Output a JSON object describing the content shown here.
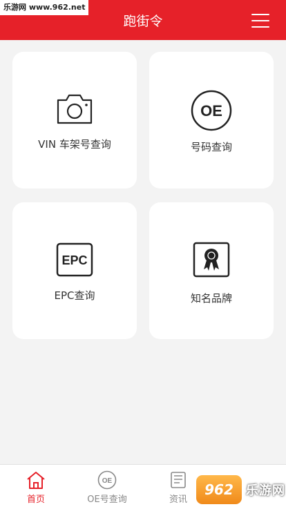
{
  "watermark": "乐游网 www.962.net",
  "header": {
    "title": "跑街令"
  },
  "cards": [
    {
      "label": "VIN 车架号查询",
      "icon": "camera-icon"
    },
    {
      "label": "号码查询",
      "icon": "oe-circle-icon",
      "icon_text": "OE"
    },
    {
      "label": "EPC查询",
      "icon": "epc-icon",
      "icon_text": "EPC"
    },
    {
      "label": "知名品牌",
      "icon": "award-icon"
    }
  ],
  "tabbar": {
    "items": [
      {
        "label": "首页",
        "icon": "home-icon",
        "active": true
      },
      {
        "label": "OE号查询",
        "icon": "oe-tab-icon",
        "icon_text": "OE"
      },
      {
        "label": "资讯",
        "icon": "news-icon"
      }
    ]
  },
  "badge": {
    "logo": "962",
    "text": "乐游网"
  },
  "colors": {
    "brand": "#e62129",
    "background": "#f3f3f3",
    "active_tab": "#e62129",
    "inactive_tab": "#888888"
  }
}
